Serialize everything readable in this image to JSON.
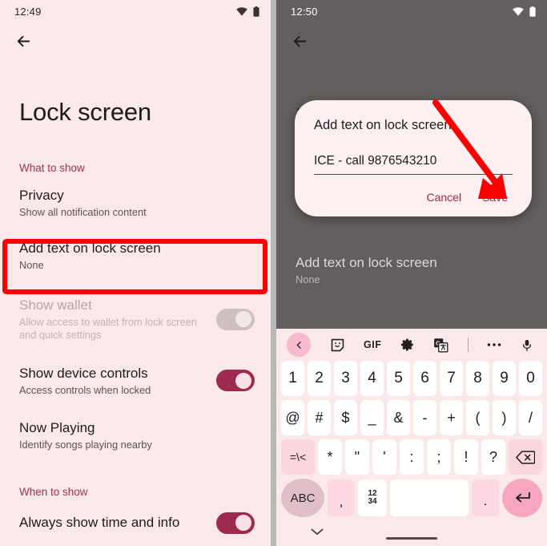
{
  "left_panel": {
    "status": {
      "time": "12:49",
      "wifi_icon": "wifi-icon",
      "battery_icon": "battery-icon"
    },
    "back_icon": "back-arrow-icon",
    "title": "Lock screen",
    "section_what_to_show": "What to show",
    "section_when_to_show": "When to show",
    "rows": [
      {
        "title": "Privacy",
        "sub": "Show all notification content",
        "toggle": null,
        "disabled": false
      },
      {
        "title": "Add text on lock screen",
        "sub": "None",
        "toggle": null,
        "disabled": false
      },
      {
        "title": "Show wallet",
        "sub": "Allow access to wallet from lock screen and quick settings",
        "toggle": "off-grey",
        "disabled": true
      },
      {
        "title": "Show device controls",
        "sub": "Access controls when locked",
        "toggle": "on",
        "disabled": false
      },
      {
        "title": "Now Playing",
        "sub": "Identify songs playing nearby",
        "toggle": null,
        "disabled": false
      }
    ],
    "last_row": {
      "title": "Always show time and info",
      "toggle": "on"
    },
    "highlight_color": "#fb0000"
  },
  "right_panel": {
    "status": {
      "time": "12:50",
      "wifi_icon": "wifi-icon",
      "battery_icon": "battery-icon"
    },
    "back_icon": "back-arrow-icon",
    "ghost_title": "L",
    "background_row": {
      "title": "Add text on lock screen",
      "sub": "None"
    },
    "dialog": {
      "title": "Add text on lock screen",
      "input_value": "ICE - call 9876543210",
      "input_placeholder": "",
      "cancel_label": "Cancel",
      "save_label": "Save",
      "accent_color": "#9e2a4f"
    },
    "arrow": {
      "color": "#fb0000",
      "points_to": "save-button"
    },
    "keyboard": {
      "toolbar": [
        {
          "name": "keyboard-back-icon",
          "label": "‹"
        },
        {
          "name": "sticker-icon",
          "label": ""
        },
        {
          "name": "gif-icon",
          "label": "GIF"
        },
        {
          "name": "gear-icon",
          "label": ""
        },
        {
          "name": "translate-icon",
          "label": ""
        },
        {
          "name": "more-options-icon",
          "label": "•••"
        },
        {
          "name": "microphone-icon",
          "label": ""
        }
      ],
      "row1": [
        "1",
        "2",
        "3",
        "4",
        "5",
        "6",
        "7",
        "8",
        "9",
        "0"
      ],
      "row2": [
        "@",
        "#",
        "$",
        "_",
        "&",
        "-",
        "+",
        "(",
        ")",
        "/"
      ],
      "row3_left": "=\\<",
      "row3": [
        "*",
        "\"",
        "'",
        ":",
        ";",
        "!",
        "?"
      ],
      "row3_backspace": "backspace-icon",
      "bottom": {
        "abc_label": "ABC",
        "comma_label": ",",
        "num_label_top": "12",
        "num_label_bottom": "34",
        "space_label": "",
        "period_label": ".",
        "enter_icon": "enter-icon"
      },
      "hide_icon": "chevron-down-icon"
    }
  }
}
